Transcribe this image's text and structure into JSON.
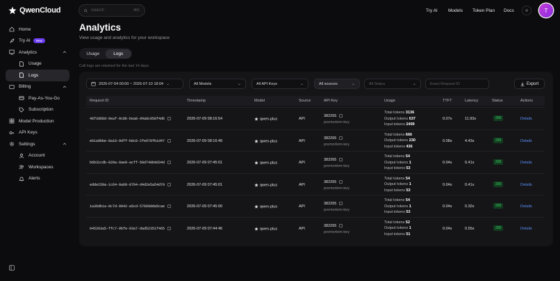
{
  "brand": {
    "name": "QwenCloud"
  },
  "search": {
    "placeholder": "Search",
    "shortcut": "⌘K"
  },
  "topnav": {
    "try_ai": "Try AI",
    "models": "Models",
    "token_plan": "Token Plan",
    "docs": "Docs",
    "avatar_initial": "T"
  },
  "sidebar": {
    "home": "Home",
    "try_ai": "Try AI",
    "try_ai_badge": "New",
    "analytics": "Analytics",
    "usage": "Usage",
    "logs": "Logs",
    "billing": "Billing",
    "pay_as_you_go": "Pay-As-You-Go",
    "subscription": "Subscription",
    "model_production": "Model Production",
    "api_keys": "API Keys",
    "settings": "Settings",
    "account": "Account",
    "workspaces": "Workspaces",
    "alerts": "Alerts"
  },
  "page": {
    "title": "Analytics",
    "subtitle": "View usage and analytics for your workspace",
    "tab_usage": "Usage",
    "tab_logs": "Logs",
    "retention": "Call logs are retained for the last 14 days."
  },
  "filters": {
    "date_range": "2026-07-04 00:00 ~ 2026-07-10 18:04",
    "models": "All Models",
    "api_keys": "All API Keys",
    "sources": "All sources",
    "status": "All Status",
    "request_id_placeholder": "Exact Request ID",
    "export": "Export"
  },
  "table": {
    "headers": {
      "request_id": "Request ID",
      "timestamp": "Timestamp",
      "model": "Model",
      "source": "Source",
      "api_key": "API Key",
      "usage": "Usage",
      "ttft": "TTFT",
      "latency": "Latency",
      "status": "Status",
      "actions": "Actions"
    },
    "labels": {
      "total": "Total tokens",
      "output": "Output tokens",
      "input": "Input tokens",
      "details": "Details"
    },
    "rows": [
      {
        "request_id": "48f3d68d-9eaf-9c8b-bea8-d4a8c958f4d6",
        "timestamp": "2026-07-09 08:16:54",
        "model": "qwen-plus",
        "source": "API",
        "key_id": "382265",
        "key_name": "premortem-key",
        "total": "3136",
        "output": "637",
        "input": "2499",
        "ttft": "0.07s",
        "latency": "11.93s",
        "status": "200"
      },
      {
        "request_id": "eb1a9bbe-8a18-9dff-b8c8-2fe970fb1d47",
        "timestamp": "2026-07-09 08:16:49",
        "model": "qwen-plus",
        "source": "API",
        "key_id": "382265",
        "key_name": "premortem-key",
        "total": "666",
        "output": "230",
        "input": "436",
        "ttft": "0.08s",
        "latency": "4.43s",
        "status": "200"
      },
      {
        "request_id": "b6b31cdb-829a-9ae9-acff-50d748b9d34d",
        "timestamp": "2026-07-09 07:45:01",
        "model": "qwen-plus",
        "source": "API",
        "key_id": "382265",
        "key_name": "premortem-key",
        "total": "54",
        "output": "1",
        "input": "53",
        "ttft": "0.04s",
        "latency": "0.41s",
        "status": "200"
      },
      {
        "request_id": "edde159a-1c64-9a60-8794-d4d2e5a54d79",
        "timestamp": "2026-07-09 07:45:01",
        "model": "qwen-plus",
        "source": "API",
        "key_id": "382265",
        "key_name": "premortem-key",
        "total": "54",
        "output": "1",
        "input": "53",
        "ttft": "0.04s",
        "latency": "0.41s",
        "status": "200"
      },
      {
        "request_id": "1a36db1a-8c7d-9942-a5cd-57669dda5cae",
        "timestamp": "2026-07-09 07:45:00",
        "model": "qwen-plus",
        "source": "API",
        "key_id": "382265",
        "key_name": "premortem-key",
        "total": "54",
        "output": "1",
        "input": "53",
        "ttft": "0.04s",
        "latency": "0.32s",
        "status": "200"
      },
      {
        "request_id": "045203a5-ffc7-9bfe-93a7-dad52351f465",
        "timestamp": "2026-07-09 07:44:46",
        "model": "qwen-plus",
        "source": "API",
        "key_id": "382265",
        "key_name": "premortem-key",
        "total": "52",
        "output": "1",
        "input": "51",
        "ttft": "0.04s",
        "latency": "0.55s",
        "status": "200"
      }
    ]
  }
}
